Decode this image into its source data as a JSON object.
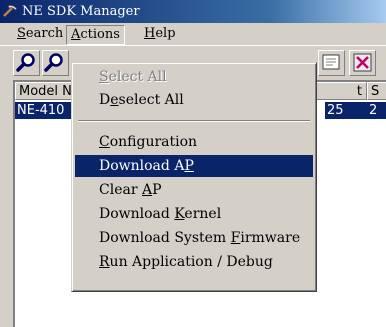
{
  "window": {
    "title": "NE SDK Manager"
  },
  "menubar": {
    "search": {
      "prefix": "",
      "ul": "S",
      "rest": "earch"
    },
    "actions": {
      "prefix": "",
      "ul": "A",
      "rest": "ctions"
    },
    "help": {
      "prefix": "",
      "ul": "H",
      "rest": "elp"
    }
  },
  "table": {
    "headers": [
      "Model N",
      "t",
      "S"
    ],
    "selected_row": {
      "model": "NE-410",
      "col2": "25",
      "col3": "2"
    }
  },
  "actions_menu": {
    "items": [
      {
        "prefix": "",
        "ul": "S",
        "rest": "elect All",
        "state": "disabled"
      },
      {
        "prefix": "D",
        "ul": "e",
        "rest": "select All",
        "state": "normal"
      },
      {
        "prefix": "",
        "ul": "C",
        "rest": "onfiguration",
        "state": "normal"
      },
      {
        "prefix": "Download A",
        "ul": "P",
        "rest": "",
        "state": "selected"
      },
      {
        "prefix": "Clear ",
        "ul": "A",
        "rest": "P",
        "state": "normal"
      },
      {
        "prefix": "Download ",
        "ul": "K",
        "rest": "ernel",
        "state": "normal"
      },
      {
        "prefix": "Download System ",
        "ul": "F",
        "rest": "irmware",
        "state": "normal"
      },
      {
        "prefix": "",
        "ul": "R",
        "rest": "un Application / Debug",
        "state": "normal"
      }
    ]
  },
  "colors": {
    "highlight": "#0a246a",
    "face": "#d4d0c8",
    "title_start": "#0a246a",
    "title_end": "#a6caf0"
  },
  "icons": [
    "app-pickaxe-icon",
    "search-magnifier-icon",
    "search-ip-icon",
    "network-icon",
    "close-x-icon"
  ]
}
